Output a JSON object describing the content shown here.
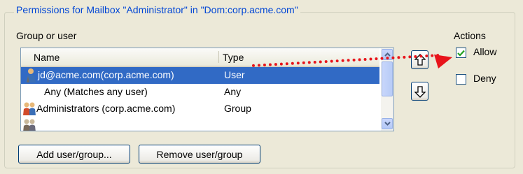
{
  "group_title": "Permissions for Mailbox \"Administrator\" in \"Dom:corp.acme.com\"",
  "group_or_user_label": "Group or user",
  "list": {
    "columns": [
      "Name",
      "Type"
    ],
    "rows": [
      {
        "name": "jd@acme.com(corp.acme.com)",
        "type": "User",
        "selected": true,
        "icon": "user-icon"
      },
      {
        "name": "Any (Matches any user)",
        "type": "Any",
        "selected": false,
        "icon": ""
      },
      {
        "name": "Administrators (corp.acme.com)",
        "type": "Group",
        "selected": false,
        "icon": "group-icon"
      }
    ]
  },
  "actions": {
    "label": "Actions",
    "allow": {
      "label": "Allow",
      "checked": true
    },
    "deny": {
      "label": "Deny",
      "checked": false
    }
  },
  "buttons": {
    "add": "Add user/group...",
    "remove": "Remove user/group"
  },
  "colors": {
    "accent": "#0046d5",
    "selection": "#316ac5",
    "annotation_arrow": "#e8141b",
    "checkmark": "#21a121"
  }
}
